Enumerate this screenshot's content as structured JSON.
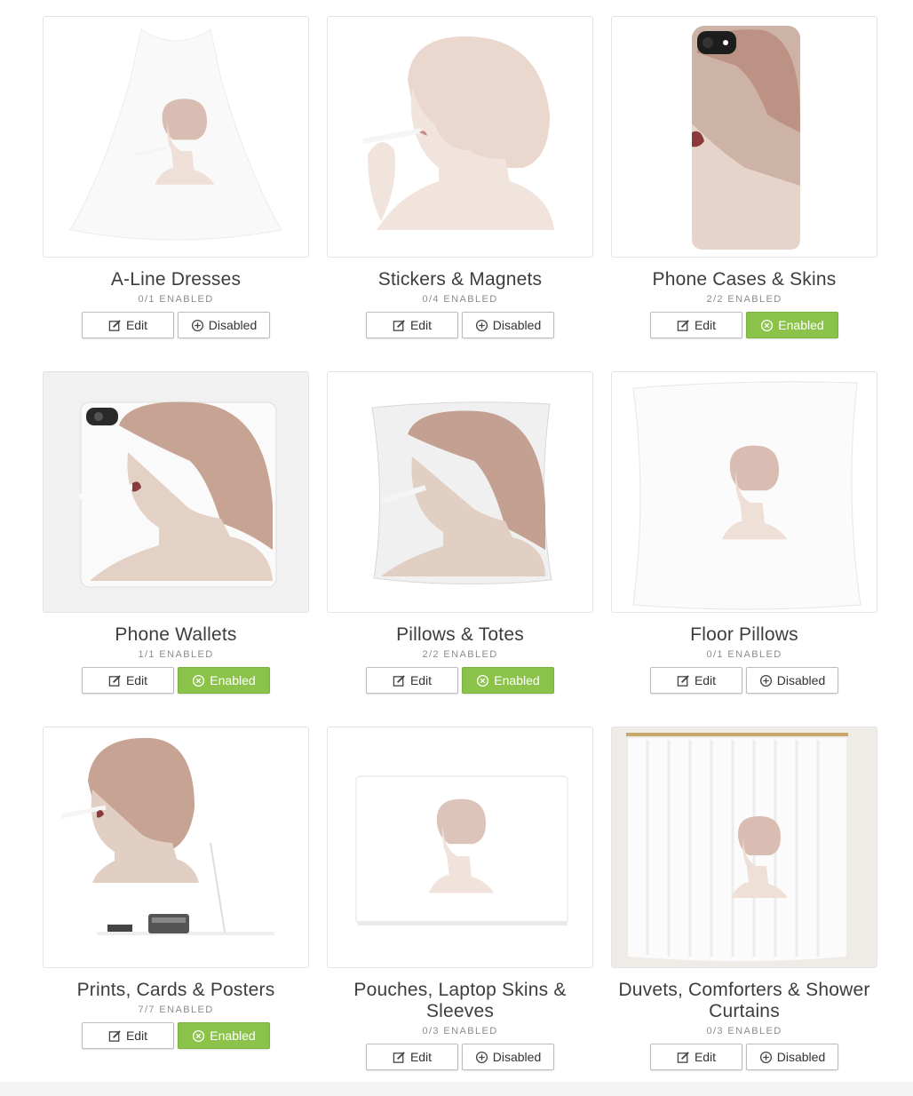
{
  "colors": {
    "enabled": "#8bc34a",
    "skin": "#e8d6cc",
    "hair": "#c9a497",
    "lips": "#8a3a3a"
  },
  "products": [
    {
      "title": "A-Line Dresses",
      "count": "0/1 ENABLED",
      "edit": "Edit",
      "status": "Disabled",
      "enabled": false,
      "image": "a-line-dress"
    },
    {
      "title": "Stickers & Magnets",
      "count": "0/4 ENABLED",
      "edit": "Edit",
      "status": "Disabled",
      "enabled": false,
      "image": "sticker"
    },
    {
      "title": "Phone Cases & Skins",
      "count": "2/2 ENABLED",
      "edit": "Edit",
      "status": "Enabled",
      "enabled": true,
      "image": "phone-case"
    },
    {
      "title": "Phone Wallets",
      "count": "1/1 ENABLED",
      "edit": "Edit",
      "status": "Enabled",
      "enabled": true,
      "image": "phone-wallet"
    },
    {
      "title": "Pillows & Totes",
      "count": "2/2 ENABLED",
      "edit": "Edit",
      "status": "Enabled",
      "enabled": true,
      "image": "pillow"
    },
    {
      "title": "Floor Pillows",
      "count": "0/1 ENABLED",
      "edit": "Edit",
      "status": "Disabled",
      "enabled": false,
      "image": "floor-pillow"
    },
    {
      "title": "Prints, Cards & Posters",
      "count": "7/7 ENABLED",
      "edit": "Edit",
      "status": "Enabled",
      "enabled": true,
      "image": "print"
    },
    {
      "title": "Pouches, Laptop Skins & Sleeves",
      "count": "0/3 ENABLED",
      "edit": "Edit",
      "status": "Disabled",
      "enabled": false,
      "image": "pouch"
    },
    {
      "title": "Duvets, Comforters & Shower Curtains",
      "count": "0/3 ENABLED",
      "edit": "Edit",
      "status": "Disabled",
      "enabled": false,
      "image": "shower-curtain"
    }
  ]
}
